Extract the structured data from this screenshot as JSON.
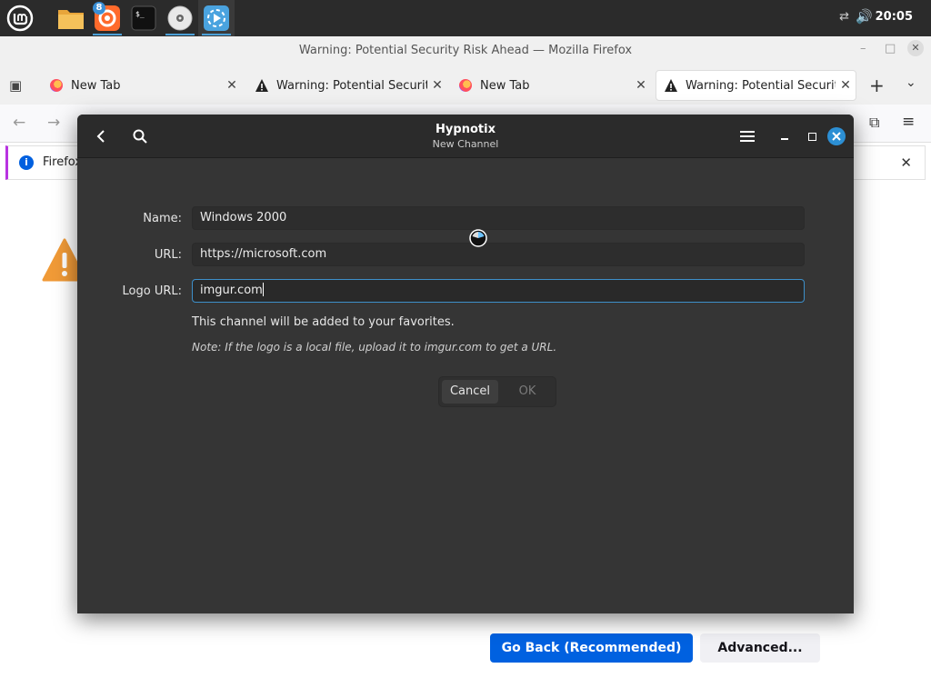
{
  "taskbar": {
    "apps": [
      {
        "name": "menu",
        "icon": "mint-logo-icon"
      },
      {
        "name": "files",
        "icon": "folder-icon"
      },
      {
        "name": "firefox",
        "icon": "firefox-icon",
        "badge": "8"
      },
      {
        "name": "terminal",
        "icon": "terminal-icon"
      },
      {
        "name": "disc",
        "icon": "disc-icon"
      },
      {
        "name": "hypnotix",
        "icon": "hypnotix-icon"
      }
    ],
    "clock": "20:05"
  },
  "firefox": {
    "window_title": "Warning: Potential Security Risk Ahead — Mozilla Firefox",
    "tabs": [
      {
        "label": "New Tab",
        "icon": "firefox-icon",
        "active": false
      },
      {
        "label": "Warning: Potential Security Risk Ahead",
        "icon": "warning-icon",
        "active": false
      },
      {
        "label": "New Tab",
        "icon": "firefox-icon",
        "active": false
      },
      {
        "label": "Warning: Potential Security Risk Ahead",
        "icon": "warning-icon",
        "active": true
      }
    ],
    "infobar_text": "Firefox",
    "go_back_label": "Go Back (Recommended)",
    "advanced_label": "Advanced..."
  },
  "hypnotix": {
    "title": "Hypnotix",
    "subtitle": "New Channel",
    "form": {
      "name_label": "Name:",
      "name_value": "Windows 2000",
      "url_label": "URL:",
      "url_value": "https://microsoft.com",
      "logo_label": "Logo URL:",
      "logo_value": "imgur.com"
    },
    "info_text": "This channel will be added to your favorites.",
    "note_text": "Note: If the logo is a local file, upload it to imgur.com to get a URL.",
    "cancel_label": "Cancel",
    "ok_label": "OK",
    "colors": {
      "accent": "#3d8fc9",
      "close": "#2c8fd4",
      "dialog_bg": "#353535"
    }
  }
}
